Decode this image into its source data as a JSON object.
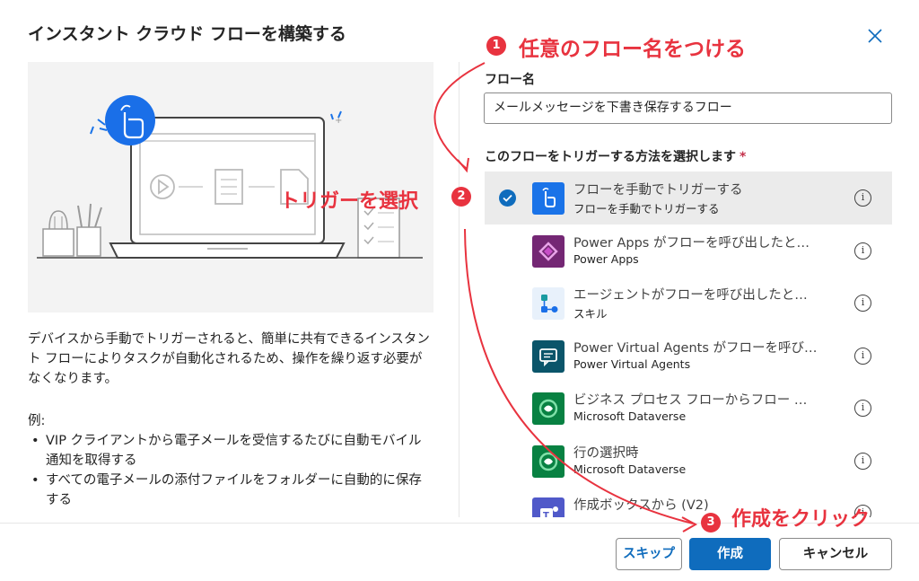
{
  "dialog": {
    "title": "インスタント クラウド フローを構築する",
    "description": "デバイスから手動でトリガーされると、簡単に共有できるインスタント フローによりタスクが自動化されるため、操作を繰り返す必要がなくなります。",
    "example_heading": "例:",
    "examples": [
      "VIP クライアントから電子メールを受信するたびに自動モバイル通知を取得する",
      "すべての電子メールの添付ファイルをフォルダーに自動的に保存する"
    ]
  },
  "form": {
    "flow_name_label": "フロー名",
    "flow_name_value": "メールメッセージを下書き保存するフロー",
    "trigger_label": "このフローをトリガーする方法を選択します",
    "required_mark": "*"
  },
  "triggers": [
    {
      "name": "フローを手動でトリガーする",
      "sub": "フローを手動でトリガーする",
      "icon": "touch-icon",
      "color": "#1a73e8",
      "selected": true
    },
    {
      "name": "Power Apps がフローを呼び出したと…",
      "sub": "Power Apps",
      "icon": "power-apps-icon",
      "color": "#742774",
      "selected": false
    },
    {
      "name": "エージェントがフローを呼び出したと…",
      "sub": "スキル",
      "icon": "skill-icon",
      "color": "#e8f1fb",
      "selected": false
    },
    {
      "name": "Power Virtual Agents がフローを呼び…",
      "sub": "Power Virtual Agents",
      "icon": "pva-icon",
      "color": "#0b556a",
      "selected": false
    },
    {
      "name": "ビジネス プロセス フローからフロー …",
      "sub": "Microsoft Dataverse",
      "icon": "dataverse-icon",
      "color": "#088142",
      "selected": false
    },
    {
      "name": "行の選択時",
      "sub": "Microsoft Dataverse",
      "icon": "dataverse-icon",
      "color": "#088142",
      "selected": false
    },
    {
      "name": "作成ボックスから (V2)",
      "sub": "",
      "icon": "teams-icon",
      "color": "#5059c9",
      "selected": false
    }
  ],
  "buttons": {
    "skip": "スキップ",
    "create": "作成",
    "cancel": "キャンセル"
  },
  "annotations": {
    "step1_num": "1",
    "step1_text": "任意のフロー名をつける",
    "step2_num": "2",
    "step2_text": "トリガーを選択",
    "step3_num": "3",
    "step3_text": "作成をクリック",
    "color": "#e8333f"
  }
}
